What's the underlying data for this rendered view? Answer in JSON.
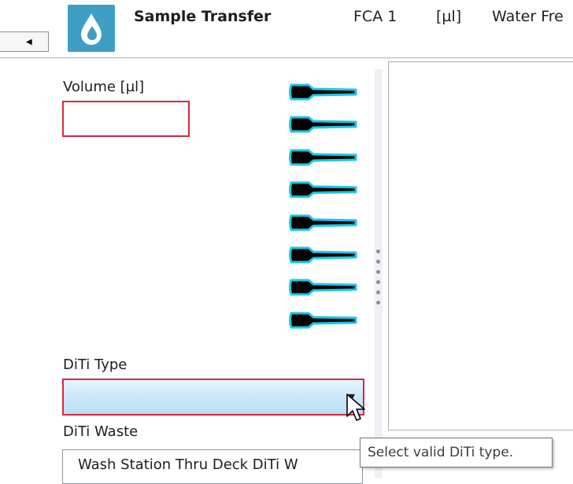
{
  "header": {
    "app_icon": "water-drops-icon",
    "title": "Sample Transfer",
    "fca": "FCA 1",
    "unit": "[µl]",
    "liquid_class": "Water Fre",
    "tab_stub_glyph": "◀"
  },
  "form": {
    "volume_label": "Volume [µl]",
    "volume_value": "",
    "diti_type_label": "DiTi Type",
    "diti_type_value": "",
    "diti_type_arrow": "▼",
    "diti_waste_label": "DiTi Waste",
    "diti_waste_value": "Wash Station Thru Deck DiTi W"
  },
  "tips": {
    "count": 8,
    "icon": "pipette-tip-icon",
    "color": "#000000",
    "highlight_color": "#19c8e6"
  },
  "tooltip": {
    "text": "Select valid DiTi type."
  },
  "colors": {
    "error_border": "#d8293a",
    "app_icon_bg": "#3d9fc4",
    "select_gradient_bottom": "#b8dff5"
  }
}
